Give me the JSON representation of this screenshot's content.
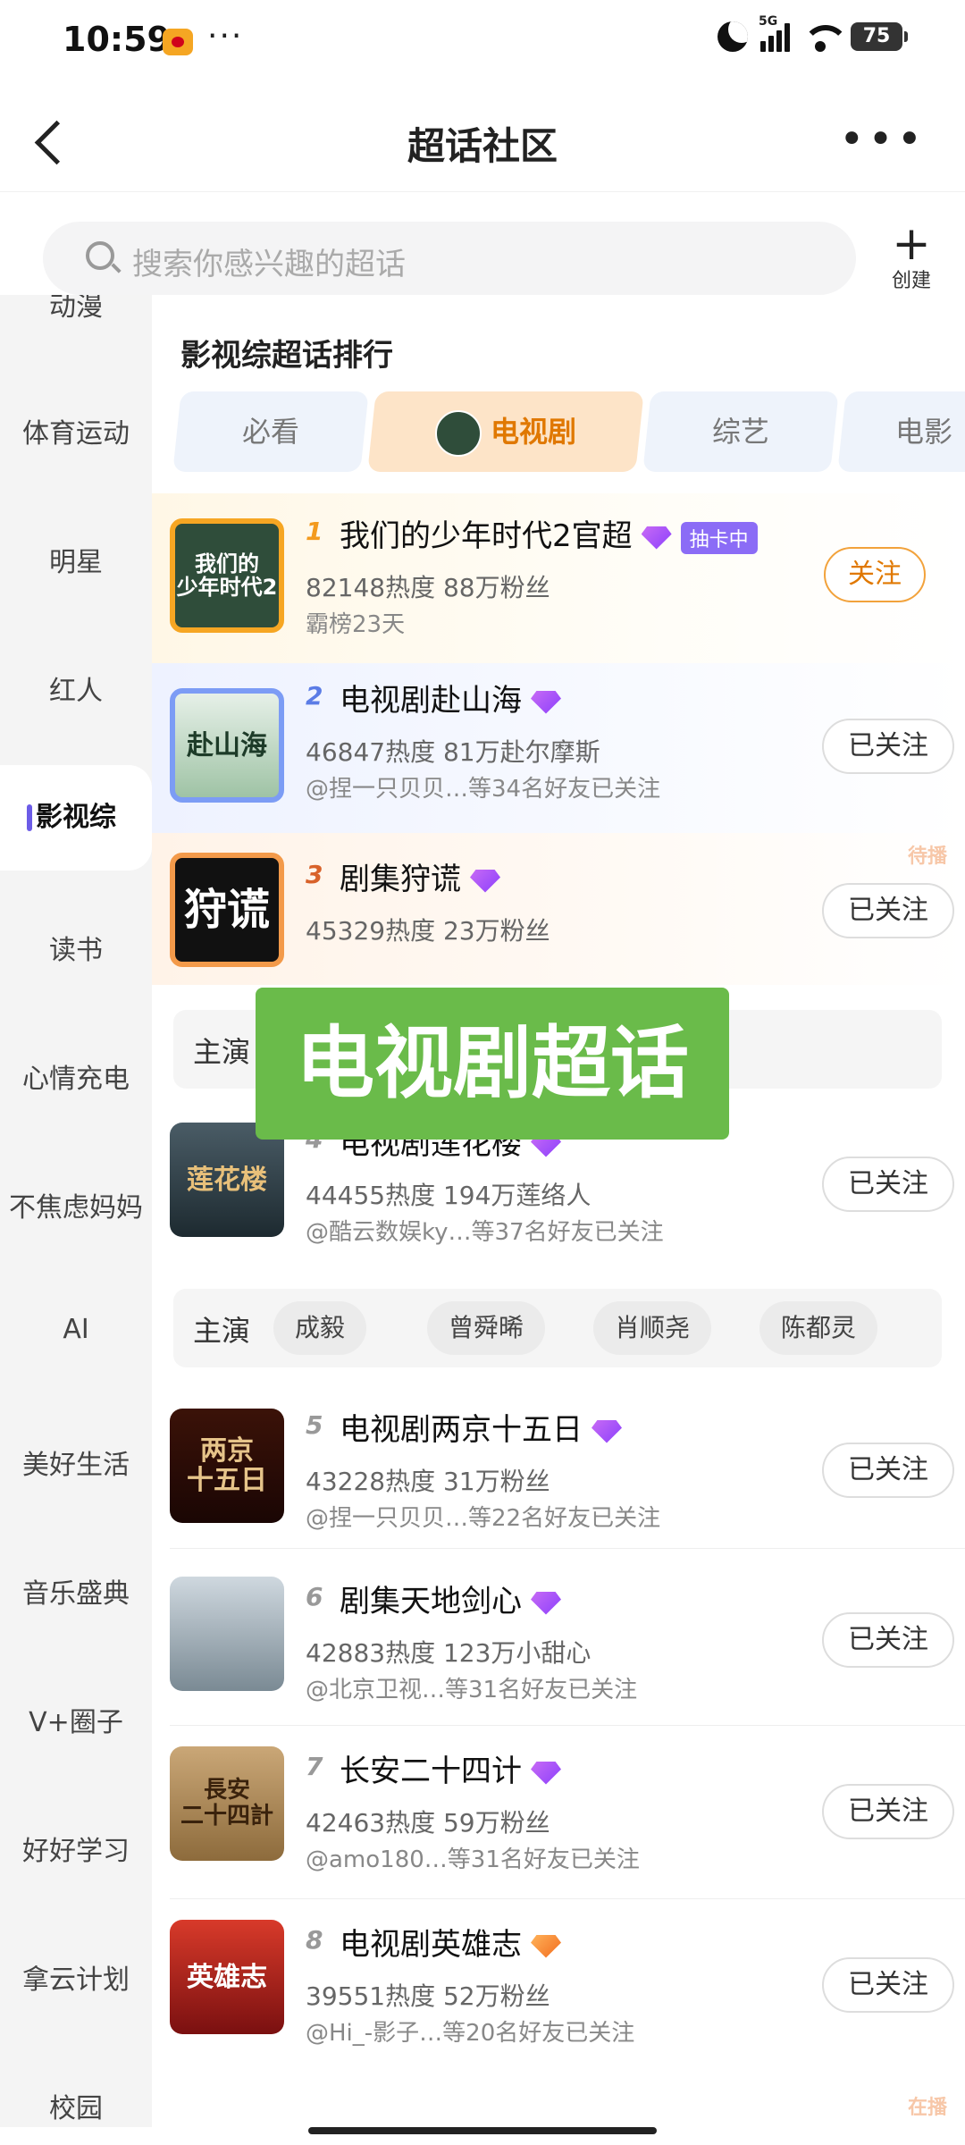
{
  "status": {
    "time": "10:59",
    "more": "···",
    "network": "5G",
    "battery": "75"
  },
  "header": {
    "title": "超话社区",
    "more": "•••"
  },
  "search": {
    "placeholder": "搜索你感兴趣的超话",
    "create_label": "创建"
  },
  "sidebar": {
    "items": [
      {
        "label": "动漫"
      },
      {
        "label": "体育运动"
      },
      {
        "label": "明星"
      },
      {
        "label": "红人"
      },
      {
        "label": "影视综"
      },
      {
        "label": "读书"
      },
      {
        "label": "心情充电"
      },
      {
        "label": "不焦虑妈妈"
      },
      {
        "label": "AI"
      },
      {
        "label": "美好生活"
      },
      {
        "label": "音乐盛典"
      },
      {
        "label": "V+圈子"
      },
      {
        "label": "好好学习"
      },
      {
        "label": "拿云计划"
      },
      {
        "label": "校园"
      }
    ],
    "active": "影视综"
  },
  "ranking": {
    "title": "影视综超话排行",
    "tabs": [
      {
        "label": "必看"
      },
      {
        "label": "电视剧"
      },
      {
        "label": "综艺"
      },
      {
        "label": "电影"
      }
    ],
    "selected_tab": "电视剧",
    "items": [
      {
        "rank": "1",
        "name": "我们的少年时代2官超",
        "badge": "抽卡中",
        "stats": "82148热度 88万粉丝",
        "sub": "霸榜23天",
        "button": "关注",
        "cover_text": "我们的\n少年时代2"
      },
      {
        "rank": "2",
        "name": "电视剧赴山海",
        "stats": "46847热度 81万赴尔摩斯",
        "sub": "@捏一只贝贝…等34名好友已关注",
        "button": "已关注",
        "cover_text": "赴山海"
      },
      {
        "rank": "3",
        "name": "剧集狩谎",
        "stats": "45329热度 23万粉丝",
        "button": "已关注",
        "ribbon": "待播",
        "cover_text": "狩谎"
      },
      {
        "rank": "4",
        "name": "电视剧莲花楼",
        "stats": "44455热度 194万莲络人",
        "sub": "@酷云数娱ky…等37名好友已关注",
        "button": "已关注",
        "cover_text": "莲花楼"
      },
      {
        "rank": "5",
        "name": "电视剧两京十五日",
        "stats": "43228热度 31万粉丝",
        "sub": "@捏一只贝贝…等22名好友已关注",
        "button": "已关注",
        "cover_text": "两京\n十五日"
      },
      {
        "rank": "6",
        "name": "剧集天地剑心",
        "stats": "42883热度 123万小甜心",
        "sub": "@北京卫视…等31名好友已关注",
        "button": "已关注",
        "cover_text": ""
      },
      {
        "rank": "7",
        "name": "长安二十四计",
        "stats": "42463热度 59万粉丝",
        "sub": "@amo180…等31名好友已关注",
        "button": "已关注",
        "cover_text": "長安\n二十四計"
      },
      {
        "rank": "8",
        "name": "电视剧英雄志",
        "stats": "39551热度 52万粉丝",
        "sub": "@Hi_-影子…等20名好友已关注",
        "button": "已关注",
        "cover_text": "英雄志"
      }
    ],
    "cast_rows": [
      {
        "label": "主演",
        "names": []
      },
      {
        "label": "主演",
        "names": [
          "成毅",
          "曾舜晞",
          "肖顺尧",
          "陈都灵"
        ]
      }
    ],
    "partial_ribbon": "在播"
  },
  "overlay_text": "电视剧超话",
  "colors": {
    "accent": "#e07800",
    "brand_purple": "#8b6cf6",
    "overlay_green": "#6abb4a"
  }
}
